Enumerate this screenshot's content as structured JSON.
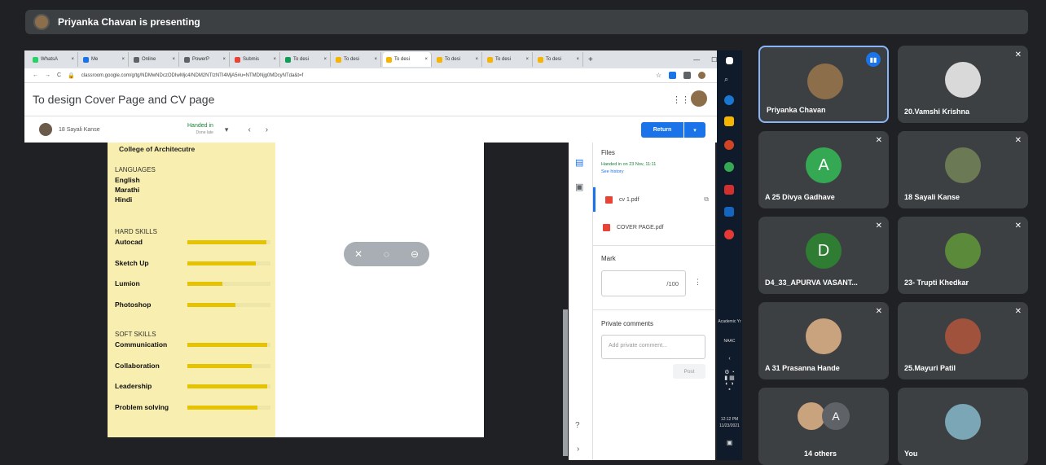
{
  "presenting": {
    "text": "Priyanka Chavan is presenting"
  },
  "browser": {
    "tabs": [
      {
        "label": "WhatsA",
        "color": "#25d366"
      },
      {
        "label": "Me",
        "color": "#1a73e8"
      },
      {
        "label": "Online",
        "color": "#5f6368"
      },
      {
        "label": "PowerP",
        "color": "#5f6368"
      },
      {
        "label": "Submis",
        "color": "#ea4335"
      },
      {
        "label": "To desi",
        "color": "#0f9d58"
      },
      {
        "label": "To desi",
        "color": "#f4b400"
      },
      {
        "label": "To desi",
        "color": "#f4b400",
        "active": true
      },
      {
        "label": "To desi",
        "color": "#f4b400"
      },
      {
        "label": "To desi",
        "color": "#f4b400"
      },
      {
        "label": "To desi",
        "color": "#f4b400"
      }
    ],
    "url": "classroom.google.com/g/tg/NDMwNDczODIwMjc4/NDM2NTIzNTI4MjA5#u=NTMDNjg0MDcyNTda&t=f"
  },
  "classroom": {
    "title": "To design Cover Page and CV page",
    "student_name": "18 Sayali Kanse",
    "status": "Handed in",
    "status_sub": "Done late",
    "return_label": "Return",
    "files_title": "Files",
    "handed_on": "Handed in on 23 Nov, 11:11",
    "see_history": "See history",
    "files": [
      "cv 1.pdf",
      "COVER PAGE.pdf"
    ],
    "mark_label": "Mark",
    "mark_value": "/100",
    "private_label": "Private comments",
    "private_placeholder": "Add private comment...",
    "post_label": "Post"
  },
  "cv": {
    "heading": "College of Architecutre",
    "languages_title": "LANGUAGES",
    "languages": [
      "English",
      "Marathi",
      "Hindi"
    ],
    "hard_title": "HARD SKILLS",
    "hard_skills": [
      {
        "name": "Autocad",
        "level": 0.95
      },
      {
        "name": "Sketch Up",
        "level": 0.82
      },
      {
        "name": "Lumion",
        "level": 0.42
      },
      {
        "name": "Photoshop",
        "level": 0.58
      }
    ],
    "soft_title": "SOFT SKILLS",
    "soft_skills": [
      {
        "name": "Communication",
        "level": 0.96
      },
      {
        "name": "Collaboration",
        "level": 0.77
      },
      {
        "name": "Leadership",
        "level": 0.96
      },
      {
        "name": "Problem solving",
        "level": 0.84
      }
    ]
  },
  "taskbar": {
    "academic": "Academic Yr",
    "naac": "NAAC",
    "time": "12:12 PM",
    "date": "11/23/2021"
  },
  "participants": [
    {
      "name": "Priyanka Chavan",
      "avatar_color": "#8d6e4a",
      "speaking": true
    },
    {
      "name": "20.Vamshi Krishna",
      "avatar_color": "#d9d9d9"
    },
    {
      "name": "A 25 Divya Gadhave",
      "initial": "A",
      "avatar_color": "#34a853"
    },
    {
      "name": "18 Sayali Kanse",
      "avatar_color": "#6b7a55"
    },
    {
      "name": "D4_33_APURVA VASANT...",
      "initial": "D",
      "avatar_color": "#2e7d32"
    },
    {
      "name": "23- Trupti Khedkar",
      "avatar_color": "#5a8a3a"
    },
    {
      "name": "A 31 Prasanna Hande",
      "avatar_color": "#c9a27e"
    },
    {
      "name": "25.Mayuri Patil",
      "avatar_color": "#a0523d"
    },
    {
      "name": "14 others",
      "initial": "A",
      "avatar_color": "#5f6368"
    },
    {
      "name": "You",
      "avatar_color": "#7aa6b5"
    }
  ]
}
